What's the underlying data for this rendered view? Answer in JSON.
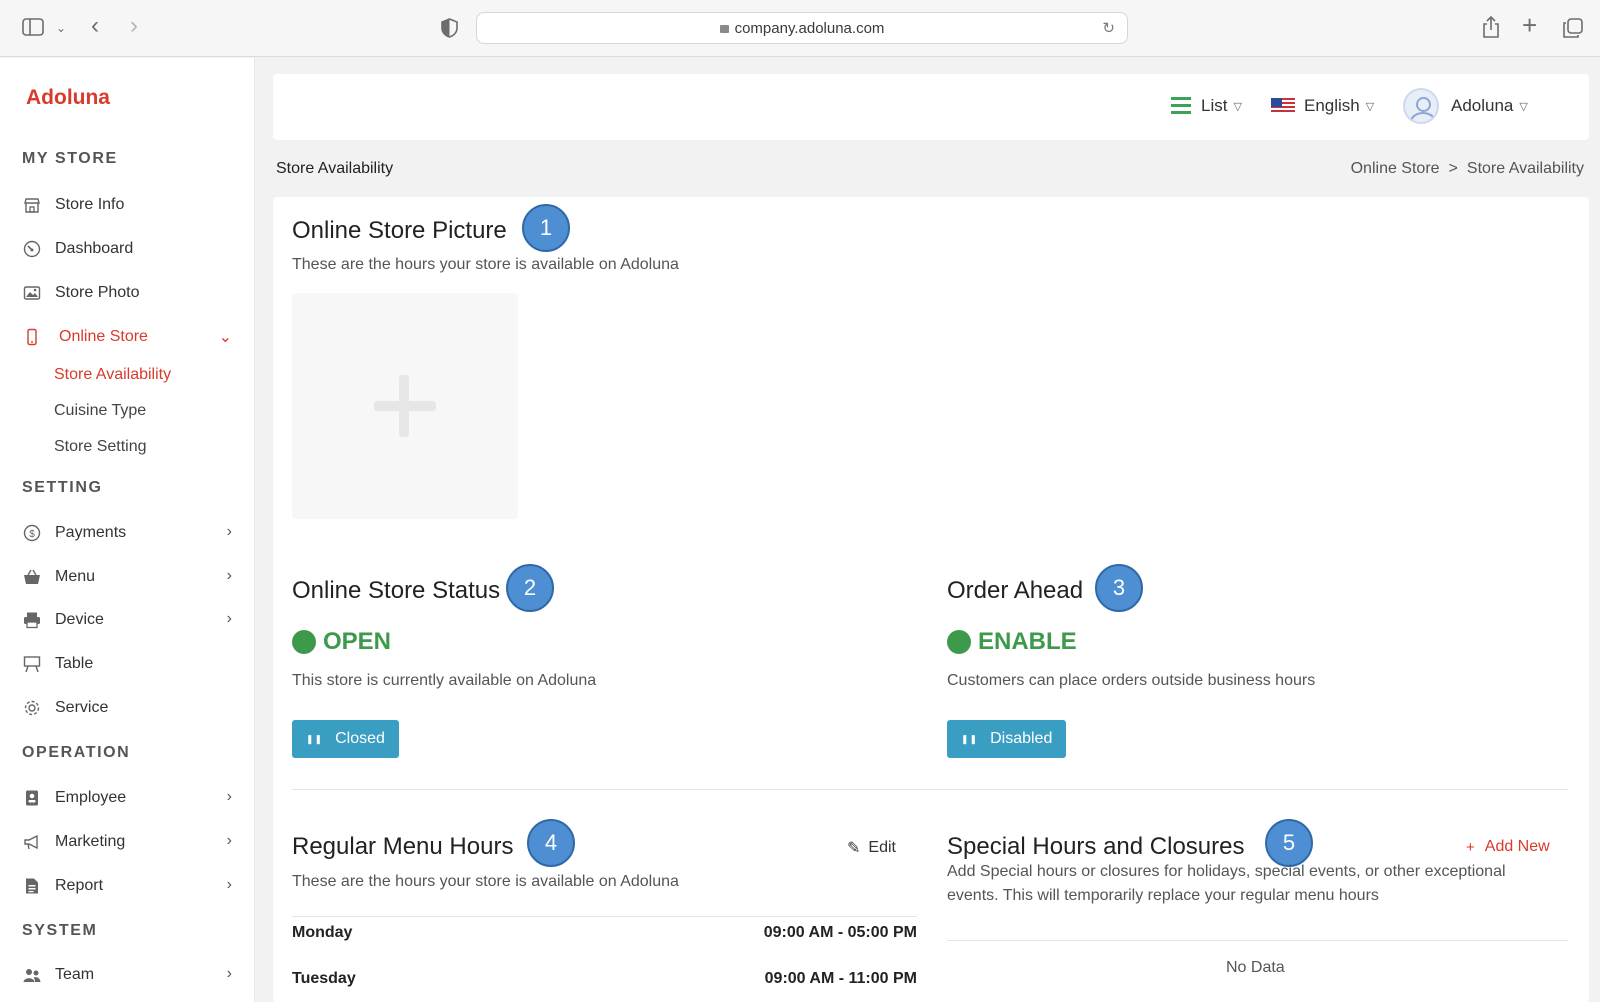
{
  "browser": {
    "url": "company.adoluna.com"
  },
  "sidebar": {
    "logo": "Adoluna",
    "sections": {
      "my_store": "MY STORE",
      "setting": "SETTING",
      "operation": "OPERATION",
      "system": "SYSTEM"
    },
    "items": {
      "store_info": "Store Info",
      "dashboard": "Dashboard",
      "store_photo": "Store Photo",
      "online_store": "Online Store",
      "payments": "Payments",
      "menu": "Menu",
      "device": "Device",
      "table": "Table",
      "service": "Service",
      "employee": "Employee",
      "marketing": "Marketing",
      "report": "Report",
      "team": "Team"
    },
    "subitems": {
      "store_availability": "Store Availability",
      "cuisine_type": "Cuisine Type",
      "store_setting": "Store Setting"
    }
  },
  "header": {
    "view_label": "List",
    "language": "English",
    "user": "Adoluna"
  },
  "breadcrumb": {
    "page_title": "Store Availability",
    "parent": "Online Store",
    "separator": ">",
    "current": "Store Availability"
  },
  "picture": {
    "title": "Online Store Picture",
    "badge": "1",
    "description": "These are the hours your store is available on Adoluna"
  },
  "store_status": {
    "title": "Online Store Status",
    "badge": "2",
    "status": "OPEN",
    "description": "This store is currently available on Adoluna",
    "button": "Closed"
  },
  "order_ahead": {
    "title": "Order Ahead",
    "badge": "3",
    "status": "ENABLE",
    "description": "Customers can place orders outside business hours",
    "button": "Disabled"
  },
  "regular_hours": {
    "title": "Regular Menu Hours",
    "badge": "4",
    "edit": "Edit",
    "description": "These are the hours your store is available on Adoluna",
    "rows": [
      {
        "day": "Monday",
        "hours": "09:00 AM - 05:00 PM"
      },
      {
        "day": "Tuesday",
        "hours": "09:00 AM - 11:00 PM"
      }
    ]
  },
  "special_hours": {
    "title": "Special Hours and Closures",
    "badge": "5",
    "add": "Add New",
    "description_line1": "Add Special hours or closures for holidays, special events, or other exceptional",
    "description_line2": "events. This will temporarily replace your regular menu hours",
    "empty": "No Data"
  },
  "colors": {
    "brand": "#d93a2b",
    "status_green": "#3d9a4a",
    "button_blue": "#3a9ec3",
    "badge_blue": "#4e8fd4"
  }
}
